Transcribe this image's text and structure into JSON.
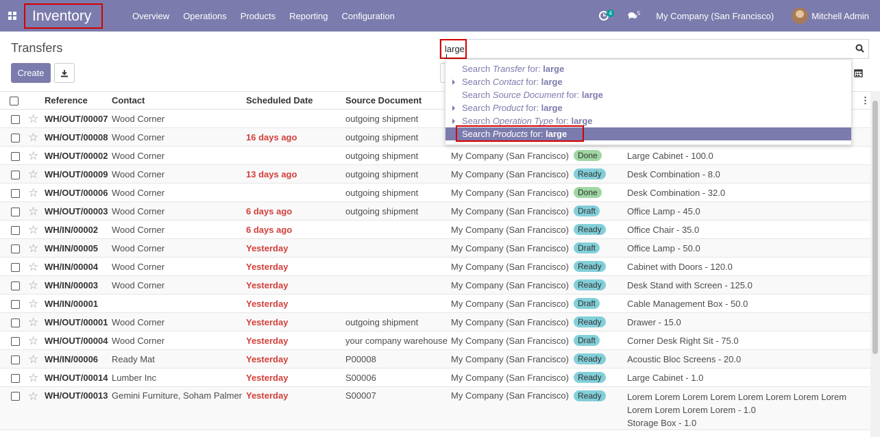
{
  "navbar": {
    "app_name": "Inventory",
    "menu": [
      "Overview",
      "Operations",
      "Products",
      "Reporting",
      "Configuration"
    ],
    "activity_count": "4",
    "message_count": "5",
    "company": "My Company (San Francisco)",
    "user": "Mitchell Admin",
    "brand_color": "#7c7bad"
  },
  "control_panel": {
    "breadcrumb": "Transfers",
    "create_label": "Create",
    "search_value": "large"
  },
  "autocomplete": [
    {
      "prefix": "Search ",
      "field": "Transfer",
      "mid": " for: ",
      "term": "large",
      "expandable": false
    },
    {
      "prefix": "Search ",
      "field": "Contact",
      "mid": " for: ",
      "term": "large",
      "expandable": true
    },
    {
      "prefix": "Search ",
      "field": "Source Document",
      "mid": " for: ",
      "term": "large",
      "expandable": false
    },
    {
      "prefix": "Search ",
      "field": "Product",
      "mid": " for: ",
      "term": "large",
      "expandable": true
    },
    {
      "prefix": "Search ",
      "field": "Operation Type",
      "mid": " for: ",
      "term": "large",
      "expandable": true
    },
    {
      "prefix": "Search ",
      "field": "Products",
      "mid": " for: ",
      "term": "large",
      "expandable": false,
      "active": true
    }
  ],
  "table": {
    "headers": [
      "Reference",
      "Contact",
      "Scheduled Date",
      "Source Document"
    ],
    "rows": [
      {
        "ref": "WH/OUT/00007",
        "contact": "Wood Corner",
        "date": "",
        "source": "outgoing shipment",
        "company": "",
        "status": "",
        "product": ""
      },
      {
        "ref": "WH/OUT/00008",
        "contact": "Wood Corner",
        "date": "16 days ago",
        "source": "outgoing shipment",
        "company": "",
        "status": "",
        "product": ""
      },
      {
        "ref": "WH/OUT/00002",
        "contact": "Wood Corner",
        "date": "",
        "source": "outgoing shipment",
        "company": "My Company (San Francisco)",
        "status": "Done",
        "product": "Large Cabinet - 100.0"
      },
      {
        "ref": "WH/OUT/00009",
        "contact": "Wood Corner",
        "date": "13 days ago",
        "source": "outgoing shipment",
        "company": "My Company (San Francisco)",
        "status": "Ready",
        "product": "Desk Combination - 8.0"
      },
      {
        "ref": "WH/OUT/00006",
        "contact": "Wood Corner",
        "date": "",
        "source": "outgoing shipment",
        "company": "My Company (San Francisco)",
        "status": "Done",
        "product": "Desk Combination - 32.0"
      },
      {
        "ref": "WH/OUT/00003",
        "contact": "Wood Corner",
        "date": "6 days ago",
        "source": "outgoing shipment",
        "company": "My Company (San Francisco)",
        "status": "Draft",
        "product": "Office Lamp - 45.0"
      },
      {
        "ref": "WH/IN/00002",
        "contact": "Wood Corner",
        "date": "6 days ago",
        "source": "",
        "company": "My Company (San Francisco)",
        "status": "Ready",
        "product": "Office Chair - 35.0"
      },
      {
        "ref": "WH/IN/00005",
        "contact": "Wood Corner",
        "date": "Yesterday",
        "source": "",
        "company": "My Company (San Francisco)",
        "status": "Draft",
        "product": "Office Lamp - 50.0"
      },
      {
        "ref": "WH/IN/00004",
        "contact": "Wood Corner",
        "date": "Yesterday",
        "source": "",
        "company": "My Company (San Francisco)",
        "status": "Ready",
        "product": "Cabinet with Doors - 120.0"
      },
      {
        "ref": "WH/IN/00003",
        "contact": "Wood Corner",
        "date": "Yesterday",
        "source": "",
        "company": "My Company (San Francisco)",
        "status": "Ready",
        "product": "Desk Stand with Screen - 125.0"
      },
      {
        "ref": "WH/IN/00001",
        "contact": "",
        "date": "Yesterday",
        "source": "",
        "company": "My Company (San Francisco)",
        "status": "Draft",
        "product": "Cable Management Box - 50.0"
      },
      {
        "ref": "WH/OUT/00001",
        "contact": "Wood Corner",
        "date": "Yesterday",
        "source": "outgoing shipment",
        "company": "My Company (San Francisco)",
        "status": "Ready",
        "product": "Drawer - 15.0"
      },
      {
        "ref": "WH/OUT/00004",
        "contact": "Wood Corner",
        "date": "Yesterday",
        "source": "your company warehouse",
        "company": "My Company (San Francisco)",
        "status": "Draft",
        "product": "Corner Desk Right Sit - 75.0"
      },
      {
        "ref": "WH/IN/00006",
        "contact": "Ready Mat",
        "date": "Yesterday",
        "source": "P00008",
        "company": "My Company (San Francisco)",
        "status": "Ready",
        "product": "Acoustic Bloc Screens - 20.0"
      },
      {
        "ref": "WH/OUT/00014",
        "contact": "Lumber Inc",
        "date": "Yesterday",
        "source": "S00006",
        "company": "My Company (San Francisco)",
        "status": "Ready",
        "product": "Large Cabinet - 1.0"
      },
      {
        "ref": "WH/OUT/00013",
        "contact": "Gemini Furniture, Soham Palmer",
        "date": "Yesterday",
        "source": "S00007",
        "company": "My Company (San Francisco)",
        "status": "Ready",
        "product": "Lorem Lorem Lorem Lorem Lorem Lorem Lorem Lorem Lorem Lorem Lorem Lorem - 1.0\nStorage Box - 1.0"
      }
    ]
  }
}
